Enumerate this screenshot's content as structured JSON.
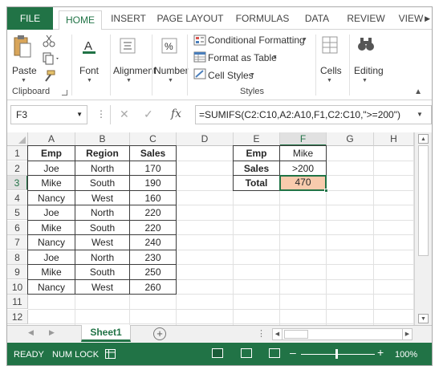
{
  "ribbon": {
    "tabs": [
      "FILE",
      "HOME",
      "INSERT",
      "PAGE LAYOUT",
      "FORMULAS",
      "DATA",
      "REVIEW",
      "VIEW"
    ],
    "active_tab": "HOME",
    "paste_label": "Paste",
    "clipboard_label": "Clipboard",
    "font_label": "Font",
    "alignment_label": "Alignment",
    "number_label": "Number",
    "conditional_formatting": "Conditional Formatting",
    "format_as_table": "Format as Table",
    "cell_styles": "Cell Styles",
    "styles_label": "Styles",
    "cells_label": "Cells",
    "editing_label": "Editing"
  },
  "formula_bar": {
    "name_box": "F3",
    "formula": "=SUMIFS(C2:C10,A2:A10,F1,C2:C10,\">=200\")",
    "fx": "fx"
  },
  "grid": {
    "columns": [
      "A",
      "B",
      "C",
      "D",
      "E",
      "F",
      "G",
      "H"
    ],
    "rows": [
      "1",
      "2",
      "3",
      "4",
      "5",
      "6",
      "7",
      "8",
      "9",
      "10",
      "11",
      "12"
    ],
    "selected_column": "F",
    "selected_row": "3"
  },
  "table": {
    "headers": [
      "Emp",
      "Region",
      "Sales"
    ],
    "rows": [
      [
        "Joe",
        "North",
        "170"
      ],
      [
        "Mike",
        "South",
        "190"
      ],
      [
        "Nancy",
        "West",
        "160"
      ],
      [
        "Joe",
        "North",
        "220"
      ],
      [
        "Mike",
        "South",
        "220"
      ],
      [
        "Nancy",
        "West",
        "240"
      ],
      [
        "Joe",
        "North",
        "230"
      ],
      [
        "Mike",
        "South",
        "250"
      ],
      [
        "Nancy",
        "West",
        "260"
      ]
    ]
  },
  "criteria": {
    "rows": [
      [
        "Emp",
        "Mike"
      ],
      [
        "Sales",
        ">200"
      ],
      [
        "Total",
        "470"
      ]
    ]
  },
  "sheets": {
    "active": "Sheet1"
  },
  "status": {
    "ready": "READY",
    "num_lock": "NUM LOCK",
    "zoom": "100%"
  },
  "colors": {
    "accent": "#217346",
    "highlight": "#f8cbad"
  }
}
